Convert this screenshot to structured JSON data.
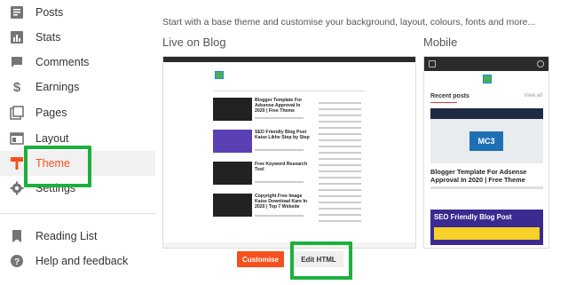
{
  "sidebar": {
    "items": [
      {
        "label": "Posts",
        "icon": "posts-icon"
      },
      {
        "label": "Stats",
        "icon": "stats-icon"
      },
      {
        "label": "Comments",
        "icon": "comments-icon"
      },
      {
        "label": "Earnings",
        "icon": "dollar-icon"
      },
      {
        "label": "Pages",
        "icon": "pages-icon"
      },
      {
        "label": "Layout",
        "icon": "layout-icon"
      },
      {
        "label": "Theme",
        "icon": "theme-icon"
      },
      {
        "label": "Settings",
        "icon": "settings-icon"
      },
      {
        "label": "Reading List",
        "icon": "bookmark-icon"
      },
      {
        "label": "Help and feedback",
        "icon": "help-icon"
      }
    ]
  },
  "main": {
    "intro": "Start with a base theme and customise your background, layout, colours, fonts and more...",
    "live_label": "Live on Blog",
    "mobile_label": "Mobile"
  },
  "preview": {
    "posts": [
      {
        "title": "Blogger Template For Adsense Approval In 2020 | Free Theme"
      },
      {
        "title": "SEO Friendly Blog Post Kaise Likhe Step by Step"
      },
      {
        "title": "Free Keyword Research Tool"
      },
      {
        "title": "Copyright Free Image Kaise Download Kare In 2020 | Top 7 Website"
      }
    ]
  },
  "mobile_preview": {
    "recent_label": "Recent posts",
    "view_all": "View all",
    "image_label": "MC3",
    "post_title": "Blogger Template For Adsense Approval In 2020 | Free Theme",
    "banner_text": "SEO Friendly Blog Post"
  },
  "buttons": {
    "customise": "Customise",
    "edit_html": "Edit HTML"
  },
  "colors": {
    "accent": "#f4511e",
    "highlight": "#1db03d",
    "text": "#333333"
  }
}
